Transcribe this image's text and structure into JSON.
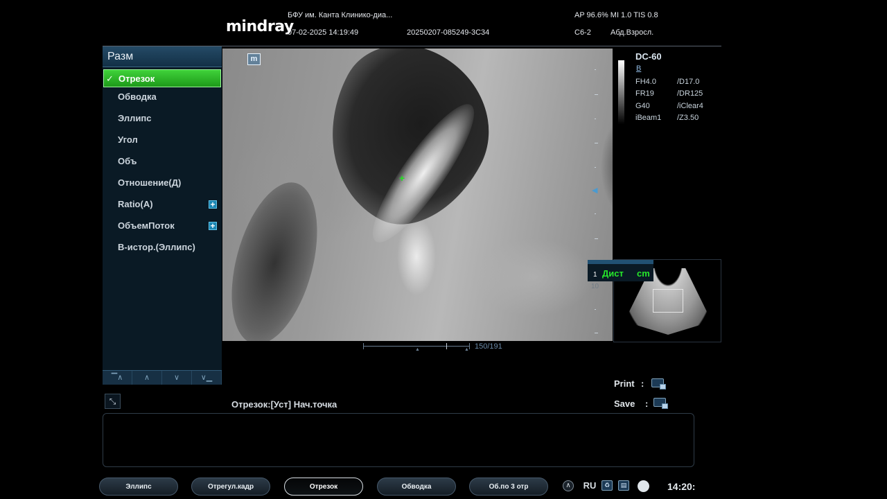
{
  "header": {
    "brand": "mindray",
    "institution": "БФУ им. Канта Клинико-диа...",
    "datetime": "07-02-2025 14:19:49",
    "exam_id": "20250207-085249-3C34",
    "acoustic": "AP 96.6%  MI 1.0 TIS 0.8",
    "probe": "C6-2",
    "preset": "Абд.Взросл."
  },
  "menu": {
    "title": "Разм",
    "items": [
      {
        "label": "Отрезок",
        "selected": true
      },
      {
        "label": "Обводка"
      },
      {
        "label": "Эллипс"
      },
      {
        "label": "Угол"
      },
      {
        "label": "Объ"
      },
      {
        "label": "Отношение(Д)"
      },
      {
        "label": "Ratio(A)",
        "expand": true
      },
      {
        "label": "ОбъемПоток",
        "expand": true
      },
      {
        "label": "В-истор.(Эллипс)"
      }
    ],
    "nav_icons": [
      "first-page-icon",
      "page-up-icon",
      "page-down-icon",
      "last-page-icon"
    ]
  },
  "image": {
    "mode_badge": "m",
    "cursor_glyph": "+"
  },
  "params": {
    "model": "DC-60",
    "mode": "B",
    "left": [
      "FH4.0",
      "FR19",
      "G40",
      "iBeam1"
    ],
    "right": [
      "/D17.0",
      "/DR125",
      "/iClear4",
      "/Z3.50"
    ]
  },
  "results": {
    "index": "1",
    "label": "Дист",
    "unit": "cm",
    "extra": "10"
  },
  "cine": {
    "frame": "150/191"
  },
  "output": {
    "print_label": "Print",
    "save_label": "Save",
    "sep": ":"
  },
  "status_text": "Отрезок:[Уст] Нач.точка",
  "softkeys": [
    {
      "label": "Эллипс"
    },
    {
      "label": "Отрегул.кадр"
    },
    {
      "label": "Отрезок",
      "active": true
    },
    {
      "label": "Обводка"
    },
    {
      "label": "Об.по 3 отр"
    }
  ],
  "tray": {
    "language": "RU",
    "time": "14:20:"
  },
  "colors": {
    "accent_green": "#26e82a",
    "menu_bg": "#0a1a25",
    "menu_header": "#254a66"
  }
}
